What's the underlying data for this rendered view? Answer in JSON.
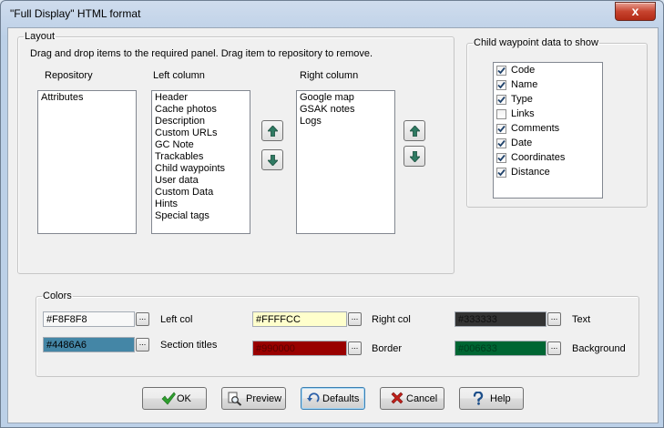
{
  "window": {
    "title": "\"Full Display\" HTML format",
    "close_label": "x"
  },
  "layout": {
    "legend": "Layout",
    "instructions": "Drag and drop items to the required panel. Drag item to repository to remove.",
    "repository": {
      "label": "Repository",
      "items": [
        "Attributes"
      ]
    },
    "left_column": {
      "label": "Left column",
      "items": [
        "Header",
        "Cache photos",
        "Description",
        "Custom URLs",
        "GC Note",
        "Trackables",
        "Child waypoints",
        "User data",
        "Custom Data",
        "Hints",
        "Special tags"
      ]
    },
    "right_column": {
      "label": "Right column",
      "items": [
        "Google map",
        "GSAK notes",
        "Logs"
      ]
    }
  },
  "child_waypoints": {
    "legend": "Child waypoint data to show",
    "items": [
      {
        "label": "Code",
        "checked": true
      },
      {
        "label": "Name",
        "checked": true
      },
      {
        "label": "Type",
        "checked": true
      },
      {
        "label": "Links",
        "checked": false
      },
      {
        "label": "Comments",
        "checked": true
      },
      {
        "label": "Date",
        "checked": true
      },
      {
        "label": "Coordinates",
        "checked": true
      },
      {
        "label": "Distance",
        "checked": true
      }
    ]
  },
  "colors": {
    "legend": "Colors",
    "left_col": {
      "label": "Left col",
      "value": "#F8F8F8",
      "bg": "#F8F8F8",
      "fg": "#000000"
    },
    "section_titles": {
      "label": "Section titles",
      "value": "#4486A6",
      "bg": "#4486A6",
      "fg": "#000000"
    },
    "right_col": {
      "label": "Right col",
      "value": "#FFFFCC",
      "bg": "#FFFFCC",
      "fg": "#000000"
    },
    "border": {
      "label": "Border",
      "value": "#990000",
      "bg": "#990000",
      "fg": "#5a0000"
    },
    "text": {
      "label": "Text",
      "value": "#333333",
      "bg": "#333333",
      "fg": "#111111"
    },
    "background": {
      "label": "Background",
      "value": "#006633",
      "bg": "#006633",
      "fg": "#003d1e"
    },
    "ellipsis": "..."
  },
  "buttons": {
    "ok": "OK",
    "preview": "Preview",
    "defaults": "Defaults",
    "cancel": "Cancel",
    "help": "Help"
  },
  "accent": {
    "ok_check": "#2e9e2e",
    "cancel_x": "#c0201a",
    "arrow": "#2f7a62"
  }
}
